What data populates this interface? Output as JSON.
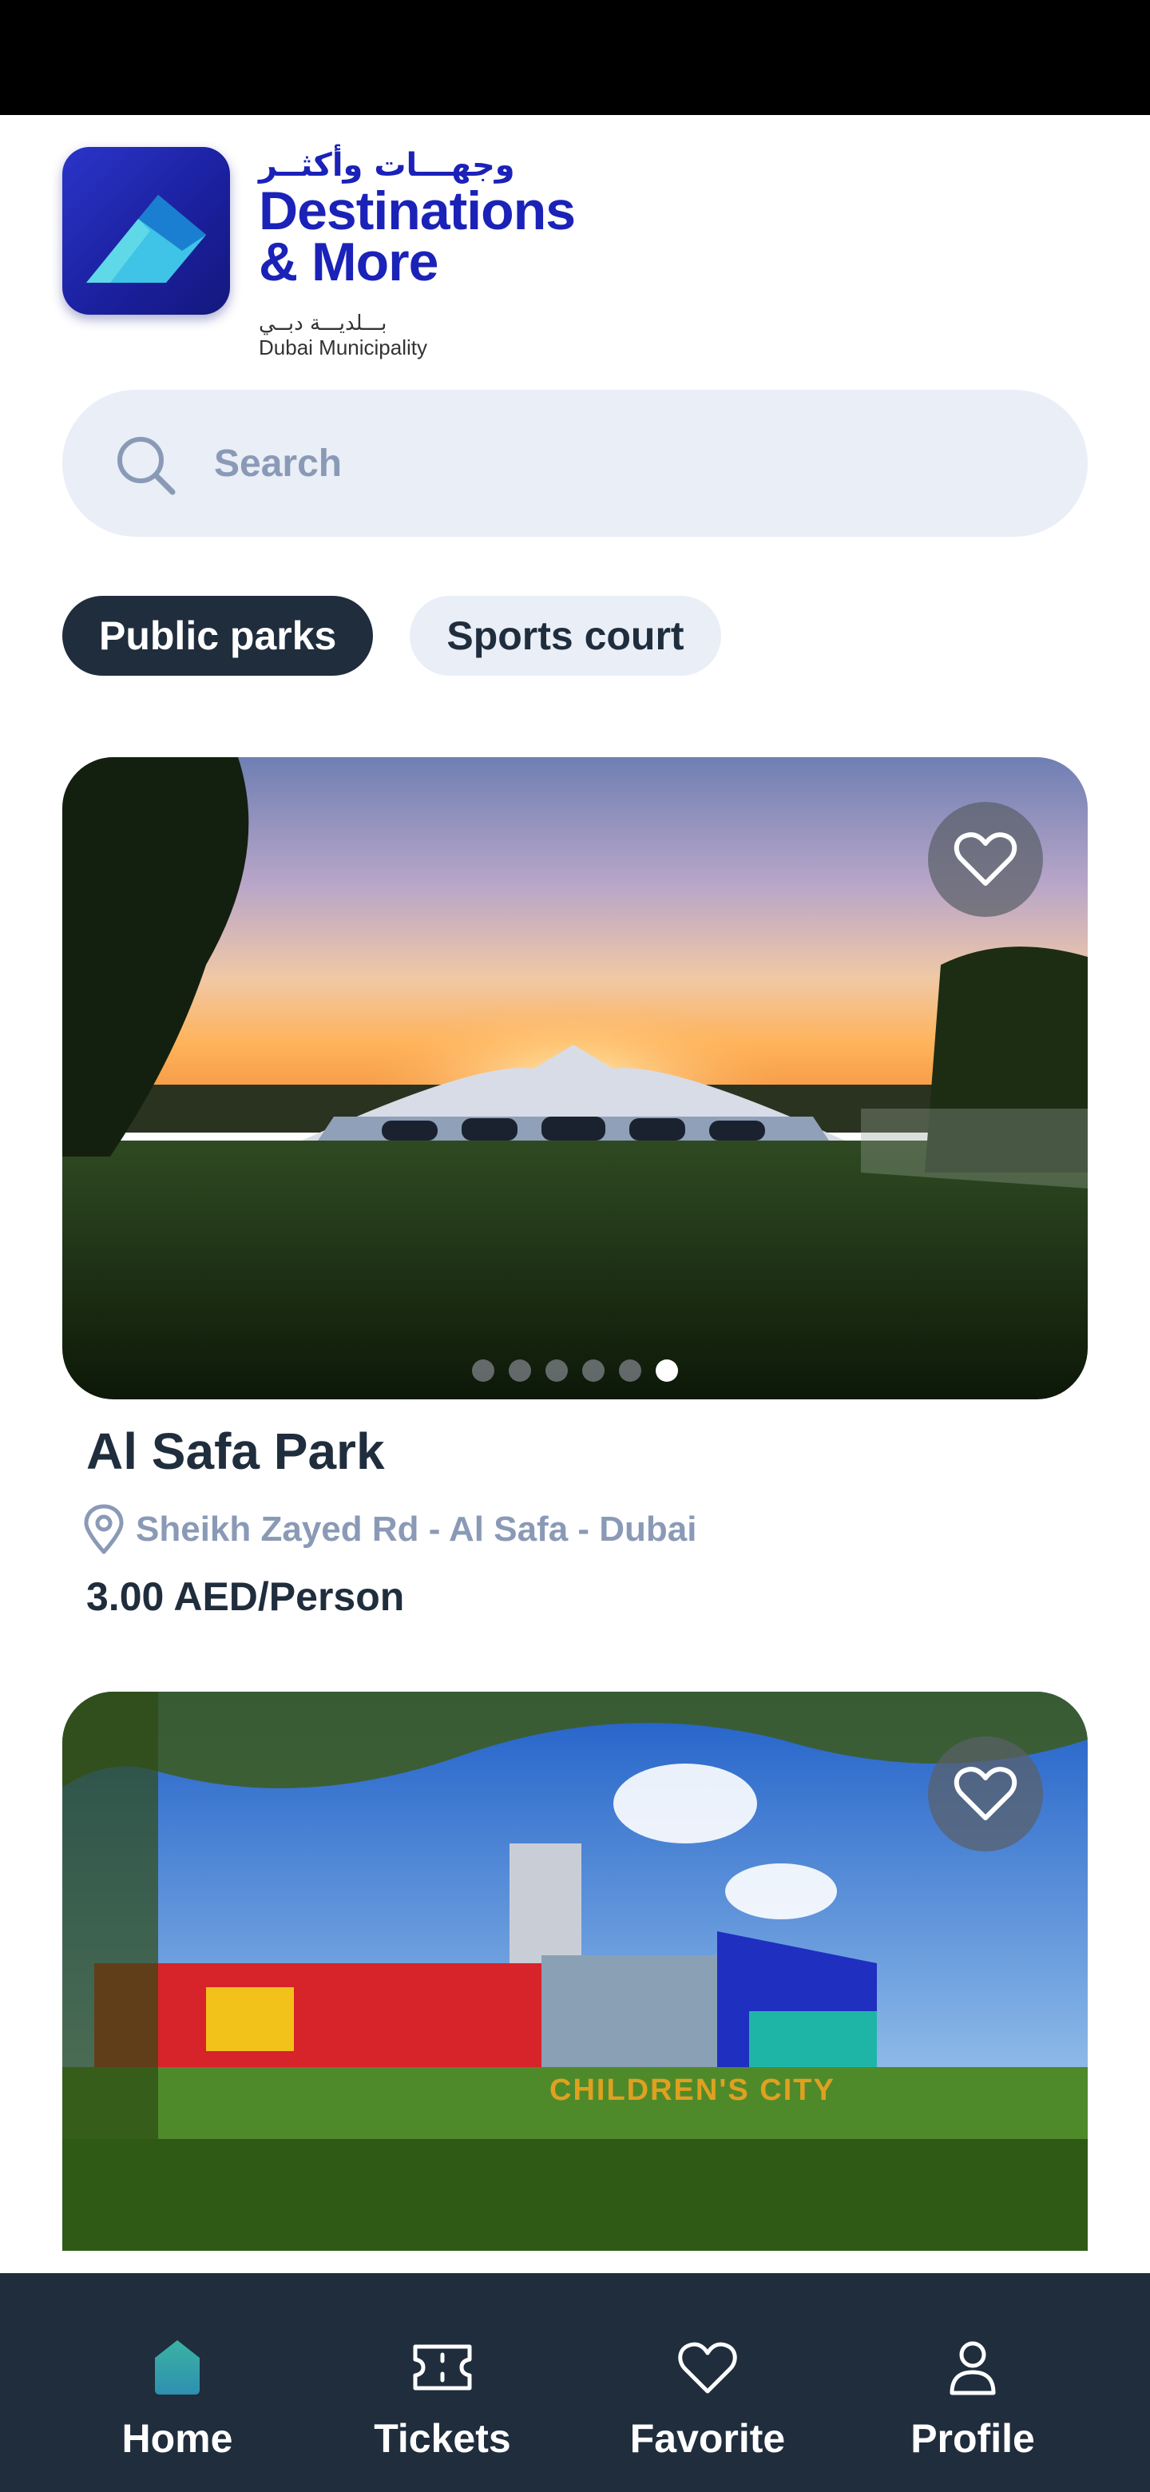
{
  "header": {
    "app_icon": "destinations-app-icon",
    "brand_arabic": "وجهـــات وأكثــر",
    "brand_line1": "Destinations",
    "brand_line2": "& More",
    "municipality_arabic": "بـــلديـــة دبــي",
    "municipality_english": "Dubai Municipality"
  },
  "search": {
    "icon": "search-icon",
    "placeholder": "Search"
  },
  "filters": {
    "chips": [
      {
        "label": "Public parks",
        "selected": true
      },
      {
        "label": "Sports court",
        "selected": false
      }
    ]
  },
  "cards": [
    {
      "title": "Al Safa Park",
      "location": "Sheikh Zayed Rd - Al Safa - Dubai",
      "price": "3.00 AED/Person",
      "favorite_icon": "heart-icon",
      "image_count": 6,
      "active_image": 6
    },
    {
      "image_sign": "CHILDREN'S CITY",
      "favorite_icon": "heart-icon"
    }
  ],
  "bottom_nav": {
    "items": [
      {
        "label": "Home",
        "icon": "home-icon",
        "active": true
      },
      {
        "label": "Tickets",
        "icon": "ticket-icon",
        "active": false
      },
      {
        "label": "Favorite",
        "icon": "heart-icon",
        "active": false
      },
      {
        "label": "Profile",
        "icon": "user-icon",
        "active": false
      }
    ]
  },
  "colors": {
    "brand_blue": "#1b22b8",
    "dark_navy": "#1f2d3d",
    "chip_bg": "#e9eef7",
    "muted_text": "#8a9ab6",
    "home_icon_teal": "#3bb3a3"
  }
}
